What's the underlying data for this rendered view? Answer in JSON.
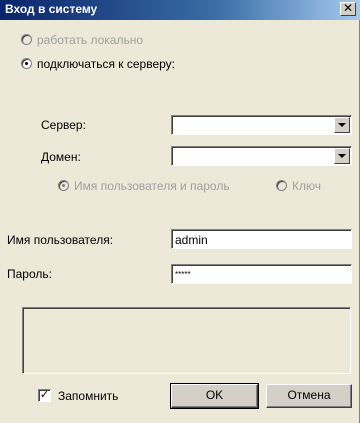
{
  "window": {
    "title": "Вход в систему",
    "close_glyph": "✕"
  },
  "mode": {
    "local_label": "работать локально",
    "server_label": "подключаться к серверу:",
    "selected": "server"
  },
  "server": {
    "label": "Сервер:",
    "value": ""
  },
  "domain": {
    "label": "Домен:",
    "value": ""
  },
  "auth": {
    "userpass_label": "Имя пользователя и пароль",
    "key_label": "Ключ",
    "selected": "userpass"
  },
  "username": {
    "label": "Имя пользователя:",
    "value": "admin"
  },
  "password": {
    "label": "Пароль:",
    "value": "*****"
  },
  "remember": {
    "label": "Запомнить",
    "checked": true,
    "check_glyph": "✓"
  },
  "buttons": {
    "ok_label": "OK",
    "cancel_label": "Отмена"
  }
}
